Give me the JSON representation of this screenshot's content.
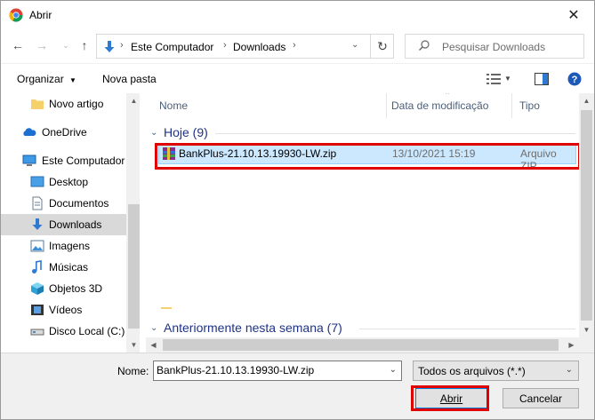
{
  "window": {
    "title": "Abrir"
  },
  "address": {
    "crumbs": [
      "Este Computador",
      "Downloads"
    ]
  },
  "search": {
    "placeholder": "Pesquisar Downloads"
  },
  "toolbar": {
    "organize": "Organizar",
    "new_folder": "Nova pasta"
  },
  "sidebar": {
    "items": [
      {
        "label": "Novo artigo",
        "icon": "folder-icon"
      },
      {
        "label": "OneDrive",
        "icon": "cloud-icon"
      },
      {
        "label": "Este Computador",
        "icon": "computer-icon"
      },
      {
        "label": "Desktop",
        "icon": "desktop-icon"
      },
      {
        "label": "Documentos",
        "icon": "documents-icon"
      },
      {
        "label": "Downloads",
        "icon": "download-icon",
        "selected": true
      },
      {
        "label": "Imagens",
        "icon": "images-icon"
      },
      {
        "label": "Músicas",
        "icon": "music-icon"
      },
      {
        "label": "Objetos 3D",
        "icon": "cube-icon"
      },
      {
        "label": "Vídeos",
        "icon": "video-icon"
      },
      {
        "label": "Disco Local (C:)",
        "icon": "drive-icon"
      }
    ]
  },
  "columns": {
    "name": "Nome",
    "date": "Data de modificação",
    "type": "Tipo"
  },
  "groups": {
    "today": "Hoje (9)",
    "this_week": "Anteriormente nesta semana (7)"
  },
  "files": [
    {
      "name": "BankPlus-21.10.13.19930-LW.zip",
      "date": "13/10/2021 15:19",
      "type": "Arquivo ZIP",
      "icon": "zip-archive-icon"
    }
  ],
  "bottom": {
    "name_label": "Nome:",
    "name_value": "BankPlus-21.10.13.19930-LW.zip",
    "filter": "Todos os arquivos (*.*)",
    "open_label": "Abrir",
    "cancel_label": "Cancelar"
  },
  "colors": {
    "highlight": "#e00000",
    "selection": "#cce8ff",
    "accent": "#0078d7",
    "group_title": "#1e3287"
  }
}
